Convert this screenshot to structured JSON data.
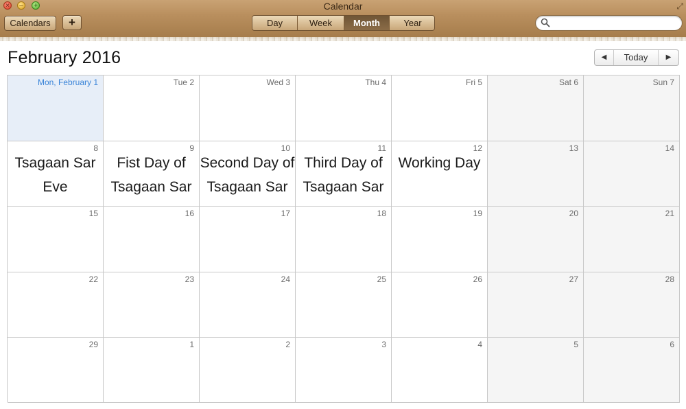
{
  "window": {
    "title": "Calendar",
    "close_glyph": "×",
    "min_glyph": "–",
    "max_glyph": "+",
    "resize_glyph": "⤢"
  },
  "toolbar": {
    "calendars_label": "Calendars",
    "add_label": "+",
    "views": {
      "day": "Day",
      "week": "Week",
      "month": "Month",
      "year": "Year",
      "selected": "Month"
    },
    "search": {
      "value": "",
      "placeholder": ""
    }
  },
  "header": {
    "month_title": "February 2016",
    "prev_glyph": "◀",
    "today_label": "Today",
    "next_glyph": "▶"
  },
  "calendar": {
    "rows": [
      [
        {
          "label": "Mon, February 1",
          "today": true,
          "event": ""
        },
        {
          "label": "Tue 2",
          "event": ""
        },
        {
          "label": "Wed 3",
          "event": ""
        },
        {
          "label": "Thu 4",
          "event": ""
        },
        {
          "label": "Fri 5",
          "event": ""
        },
        {
          "label": "Sat 6",
          "event": ""
        },
        {
          "label": "Sun 7",
          "event": ""
        }
      ],
      [
        {
          "label": "8",
          "event": "Tsagaan Sar Eve"
        },
        {
          "label": "9",
          "event": "Fist Day of Tsagaan Sar"
        },
        {
          "label": "10",
          "event": "Second Day of Tsagaan Sar"
        },
        {
          "label": "11",
          "event": "Third Day of Tsagaan Sar"
        },
        {
          "label": "12",
          "event": "Working Day"
        },
        {
          "label": "13",
          "event": ""
        },
        {
          "label": "14",
          "event": ""
        }
      ],
      [
        {
          "label": "15",
          "event": ""
        },
        {
          "label": "16",
          "event": ""
        },
        {
          "label": "17",
          "event": ""
        },
        {
          "label": "18",
          "event": ""
        },
        {
          "label": "19",
          "event": ""
        },
        {
          "label": "20",
          "event": ""
        },
        {
          "label": "21",
          "event": ""
        }
      ],
      [
        {
          "label": "22",
          "event": ""
        },
        {
          "label": "23",
          "event": ""
        },
        {
          "label": "24",
          "event": ""
        },
        {
          "label": "25",
          "event": ""
        },
        {
          "label": "26",
          "event": ""
        },
        {
          "label": "27",
          "event": ""
        },
        {
          "label": "28",
          "event": ""
        }
      ],
      [
        {
          "label": "29",
          "event": ""
        },
        {
          "label": "1",
          "event": ""
        },
        {
          "label": "2",
          "event": ""
        },
        {
          "label": "3",
          "event": ""
        },
        {
          "label": "4",
          "event": ""
        },
        {
          "label": "5",
          "event": ""
        },
        {
          "label": "6",
          "event": ""
        }
      ]
    ]
  },
  "colors": {
    "today_bg": "#e7eef8",
    "today_text": "#3a84d8",
    "weekend_bg": "#f5f5f5",
    "grid_line": "#c8c8c8",
    "toolbar_leather": "#b98f5e"
  }
}
